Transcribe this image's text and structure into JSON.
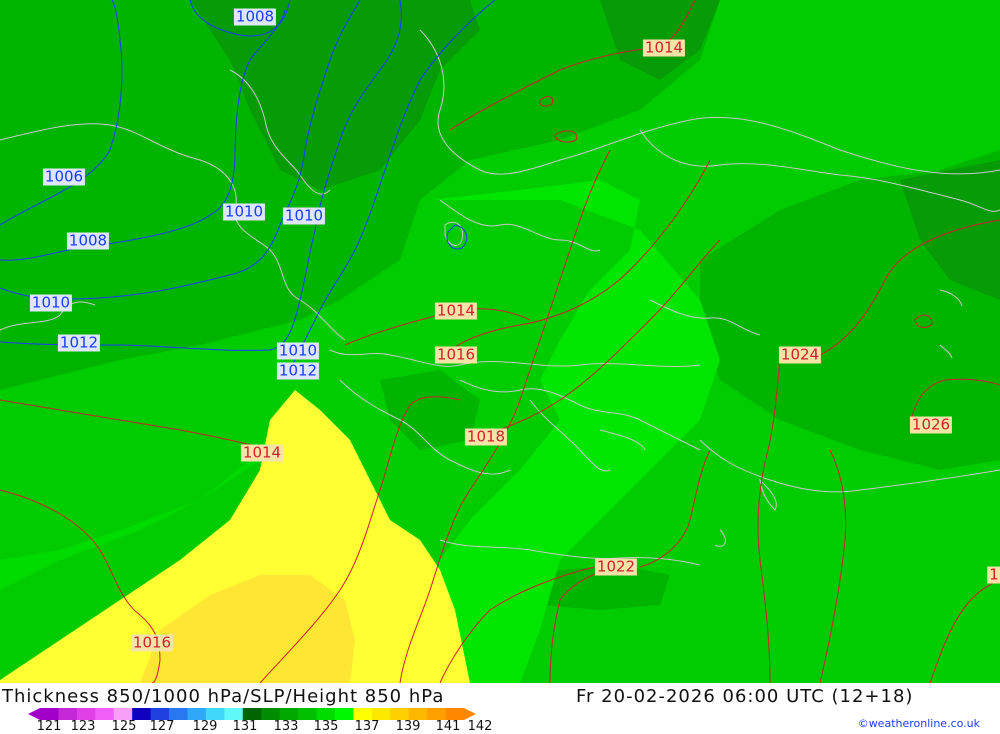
{
  "map": {
    "colors": {
      "shade_131": "#06a006",
      "shade_133": "#00b800",
      "shade_135": "#00d400",
      "shade_137": "#00ec00",
      "shade_139": "#ffff33",
      "shade_139b": "#ffe633",
      "isobar_blue": "#1a3cff",
      "isobar_red": "#d0202a",
      "coastline": "#c8c8c8"
    },
    "isobar_labels_blue": [
      "1008",
      "1006",
      "1010",
      "1010",
      "1008",
      "1010",
      "1012",
      "1010",
      "1012"
    ],
    "isobar_labels_red": [
      "1014",
      "1014",
      "1016",
      "1018",
      "1014",
      "1016",
      "1024",
      "1026",
      "1022",
      "1"
    ]
  },
  "footer": {
    "title": "Thickness 850/1000 hPa/SLP/Height 850 hPa",
    "valid_time": "Fr 20-02-2026 06:00 UTC (12+18)",
    "credit": "©weatheronline.co.uk",
    "legend_ticks": [
      "121",
      "123",
      "125",
      "127",
      "129",
      "131",
      "133",
      "135",
      "137",
      "139",
      "141",
      "142"
    ],
    "legend_colors": [
      "#a000c8",
      "#c428d8",
      "#e040e8",
      "#f060f8",
      "#f8a0f8",
      "#1000c0",
      "#2040e0",
      "#2878f0",
      "#30a8f8",
      "#40d8f8",
      "#60f8f8",
      "#006400",
      "#008c00",
      "#00a800",
      "#00c000",
      "#00dc00",
      "#00f800",
      "#ffff00",
      "#ffe800",
      "#ffd000",
      "#ffb800",
      "#ffa000",
      "#ff8800"
    ]
  }
}
